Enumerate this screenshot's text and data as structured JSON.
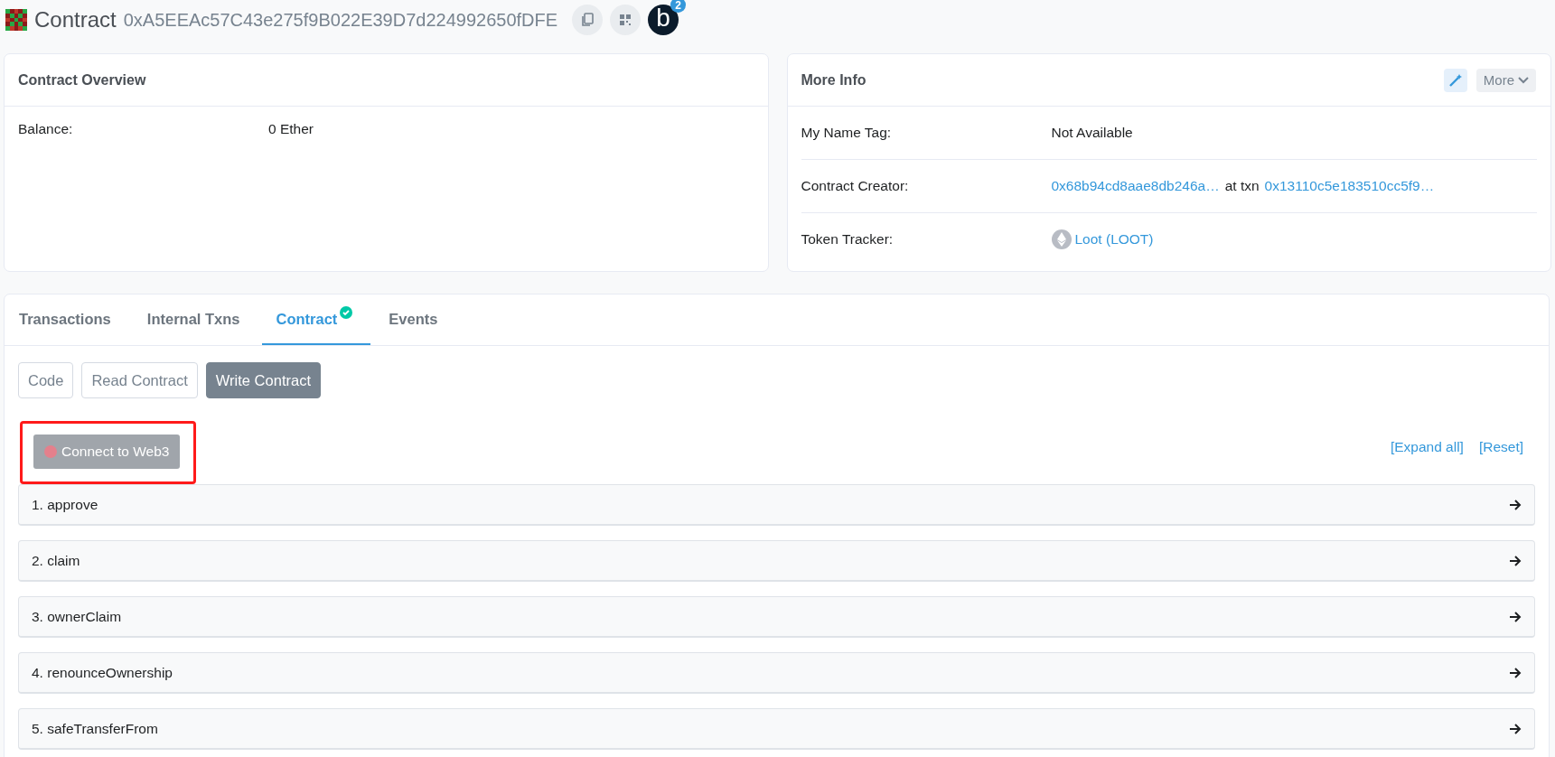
{
  "header": {
    "title": "Contract",
    "address": "0xA5EEAc57C43e275f9B022E39D7d224992650fDFE",
    "app_letter": "b",
    "app_count": "2"
  },
  "overview": {
    "title": "Contract Overview",
    "rows": [
      {
        "label": "Balance:",
        "value": "0 Ether"
      }
    ]
  },
  "more_info": {
    "title": "More Info",
    "more_button": "More",
    "rows": [
      {
        "kind": "text",
        "label": "My Name Tag:",
        "value": "Not Available"
      },
      {
        "kind": "creator",
        "label": "Contract Creator:",
        "creator": "0x68b94cd8aae8db246a…",
        "at_txn": "at txn",
        "txn": "0x13110c5e183510cc5f9…"
      },
      {
        "kind": "token",
        "label": "Token Tracker:",
        "token": "Loot (LOOT)"
      }
    ]
  },
  "tabs": [
    {
      "label": "Transactions",
      "selected": false,
      "verified": false
    },
    {
      "label": "Internal Txns",
      "selected": false,
      "verified": false
    },
    {
      "label": "Contract",
      "selected": true,
      "verified": true
    },
    {
      "label": "Events",
      "selected": false,
      "verified": false
    }
  ],
  "sub_tabs": [
    {
      "label": "Code",
      "selected": false
    },
    {
      "label": "Read Contract",
      "selected": false
    },
    {
      "label": "Write Contract",
      "selected": true
    }
  ],
  "connect": {
    "label": "Connect to Web3",
    "connected": false
  },
  "links": [
    "[Expand all]",
    "[Reset]"
  ],
  "functions": [
    "1. approve",
    "2. claim",
    "3. ownerClaim",
    "4. renounceOwnership",
    "5. safeTransferFrom"
  ]
}
